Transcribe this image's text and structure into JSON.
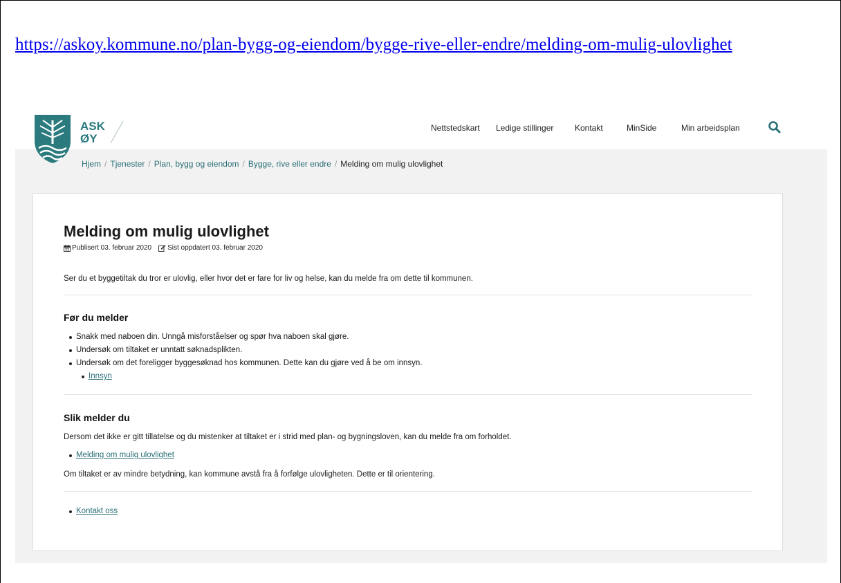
{
  "document": {
    "url_text": "https://askoy.kommune.no/plan-bygg-og-eiendom/bygge-rive-eller-endre/melding-om-mulig-ulovlighet"
  },
  "header": {
    "logo": {
      "line1": "ASK",
      "line2": "ØY"
    },
    "nav": [
      {
        "label": "Nettstedskart"
      },
      {
        "label": "Ledige stillinger"
      },
      {
        "label": "Kontakt"
      },
      {
        "label": "MinSide"
      },
      {
        "label": "Min arbeidsplan"
      }
    ],
    "search_icon": "search-icon"
  },
  "breadcrumb": {
    "items": [
      {
        "label": "Hjem"
      },
      {
        "label": "Tjenester"
      },
      {
        "label": "Plan, bygg og eiendom"
      },
      {
        "label": "Bygge, rive eller endre"
      }
    ],
    "current": "Melding om mulig ulovlighet",
    "separator": "/"
  },
  "article": {
    "title": "Melding om mulig ulovlighet",
    "published": "Publisert 03. februar 2020",
    "updated": "Sist oppdatert 03. februar 2020",
    "intro": "Ser du et byggetiltak du tror er ulovlig, eller hvor det er fare for liv og helse, kan du melde fra om dette til kommunen.",
    "section1": {
      "heading": "Før du melder",
      "items": [
        "Snakk med naboen din. Unngå misforståelser og spør hva naboen skal gjøre.",
        "Undersøk om tiltaket er unntatt søknadsplikten.",
        "Undersøk om det foreligger byggesøknad hos kommunen. Dette kan du gjøre ved å be om innsyn."
      ],
      "sub_link": "Innsyn"
    },
    "section2": {
      "heading": "Slik melder du",
      "paragraph1": "Dersom det ikke er gitt tillatelse og du mistenker at tiltaket er i strid med plan- og bygningsloven, kan du melde fra om forholdet.",
      "link": "Melding om mulig ulovlighet",
      "paragraph2": "Om tiltaket er av mindre betydning, kan kommune avstå fra å forfølge ulovligheten. Dette er til orientering."
    },
    "footer_link": "Kontakt oss"
  },
  "colors": {
    "brand": "#2a7a7e",
    "link": "#2a6f77",
    "url_link": "#0000ee",
    "background": "#f2f2f2"
  }
}
